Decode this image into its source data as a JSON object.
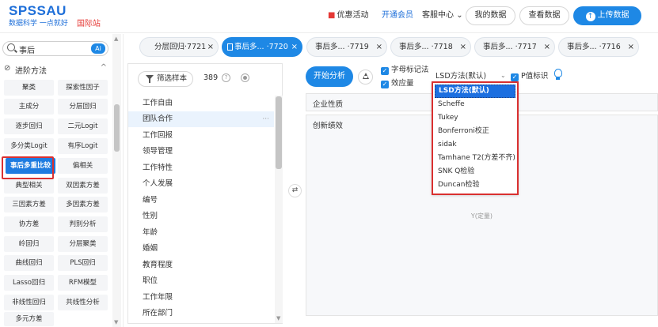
{
  "header": {
    "brand": "SPSSAU",
    "slogan": "数据科学 一点就好",
    "intl": "国际站",
    "promo": "优惠活动",
    "vip": "开通会员",
    "support": "客服中心",
    "support_caret": "⌄",
    "my_data": "我的数据",
    "view_data": "查看数据",
    "upload": "上传数据",
    "upload_icon_glyph": "↑",
    "gift_glyph": "■"
  },
  "sidebar": {
    "search_value": "事后",
    "ai_badge": "Ai",
    "category": "进阶方法",
    "category_icon_glyph": "⊘",
    "collapse_glyph": "^",
    "methods": [
      "聚类",
      "探索性因子",
      "主成分",
      "分层回归",
      "逐步回归",
      "二元Logit",
      "多分类Logit",
      "有序Logit",
      "事后多重比较",
      "偏相关",
      "典型相关",
      "双因素方差",
      "三因素方差",
      "多因素方差",
      "协方差",
      "判别分析",
      "岭回归",
      "分层聚类",
      "曲线回归",
      "PLS回归",
      "Lasso回归",
      "RFM模型",
      "非线性回归",
      "共线性分析",
      "多元方差",
      ""
    ],
    "active_method": "事后多重比较"
  },
  "tabs": [
    {
      "label": "分层回归·7721",
      "close": "×"
    },
    {
      "label": "事后多... ·7720",
      "close": "×",
      "active": true
    },
    {
      "label": "事后多... ·7719",
      "close": "×"
    },
    {
      "label": "事后多... ·7718",
      "close": "×"
    },
    {
      "label": "事后多... ·7717",
      "close": "×"
    },
    {
      "label": "事后多... ·7716",
      "close": "×"
    }
  ],
  "variable_panel": {
    "filter_label": "筛选样本",
    "count": "389",
    "help_glyph": "?",
    "variables": [
      "工作自由",
      "团队合作",
      "工作回报",
      "领导管理",
      "工作特性",
      "个人发展",
      "编号",
      "性别",
      "年龄",
      "婚姻",
      "教育程度",
      "职位",
      "工作年限",
      "所在部门"
    ],
    "highlighted": "团队合作",
    "more_glyph": "···"
  },
  "swap_glyph": "⇄",
  "analysis": {
    "start_label": "开始分析",
    "letter_mark_label": "字母标记法",
    "effect_label": "效应量",
    "check_glyph": "✓",
    "method_value": "LSD方法(默认)",
    "method_chevron": "⌄",
    "p_label": "P值标识",
    "x_zone_title": "企业性质",
    "y_zone_title": "创新绩效",
    "y_placeholder": "Y(定量)"
  },
  "dropdown": {
    "options": [
      "LSD方法(默认)",
      "Scheffe",
      "Tukey",
      "Bonferroni校正",
      "sidak",
      "Tamhane T2(方差不齐)",
      "SNK Q检验",
      "Duncan检验"
    ],
    "selected": "LSD方法(默认)"
  }
}
